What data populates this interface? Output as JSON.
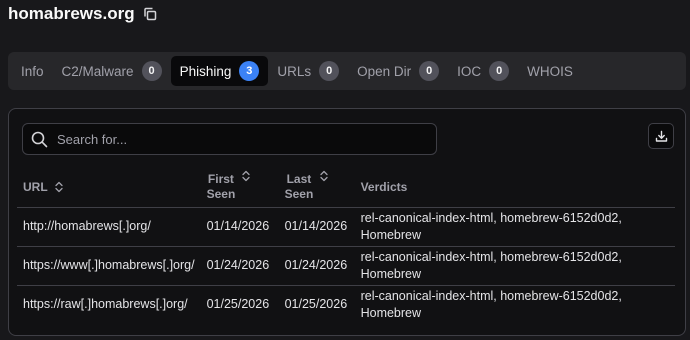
{
  "header": {
    "domain": "homabrews.org"
  },
  "tabs": [
    {
      "label": "Info",
      "badge": null,
      "active": false
    },
    {
      "label": "C2/Malware",
      "badge": "0",
      "active": false
    },
    {
      "label": "Phishing",
      "badge": "3",
      "active": true
    },
    {
      "label": "URLs",
      "badge": "0",
      "active": false
    },
    {
      "label": "Open Dir",
      "badge": "0",
      "active": false
    },
    {
      "label": "IOC",
      "badge": "0",
      "active": false
    },
    {
      "label": "WHOIS",
      "badge": null,
      "active": false
    }
  ],
  "search": {
    "placeholder": "Search for..."
  },
  "table": {
    "headers": {
      "url": "URL",
      "first_seen_1": "First",
      "first_seen_2": "Seen",
      "last_seen_1": "Last",
      "last_seen_2": "Seen",
      "verdicts": "Verdicts"
    },
    "rows": [
      {
        "url": "http://homabrews[.]org/",
        "first_seen": "01/14/2026",
        "last_seen": "01/14/2026",
        "verdicts_1": "rel-canonical-index-html, homebrew-6152d0d2,",
        "verdicts_2": "Homebrew"
      },
      {
        "url": "https://www[.]homabrews[.]org/",
        "first_seen": "01/24/2026",
        "last_seen": "01/24/2026",
        "verdicts_1": "rel-canonical-index-html, homebrew-6152d0d2,",
        "verdicts_2": "Homebrew"
      },
      {
        "url": "https://raw[.]homabrews[.]org/",
        "first_seen": "01/25/2026",
        "last_seen": "01/25/2026",
        "verdicts_1": "rel-canonical-index-html, homebrew-6152d0d2,",
        "verdicts_2": "Homebrew"
      }
    ]
  },
  "icons": {
    "copy": "copy-icon",
    "search": "search-icon",
    "download": "download-icon",
    "sort": "sort-icon"
  },
  "colors": {
    "background": "#18181b",
    "active_tab": "#09090b",
    "active_badge": "#3b82f6",
    "badge": "#52525b"
  }
}
